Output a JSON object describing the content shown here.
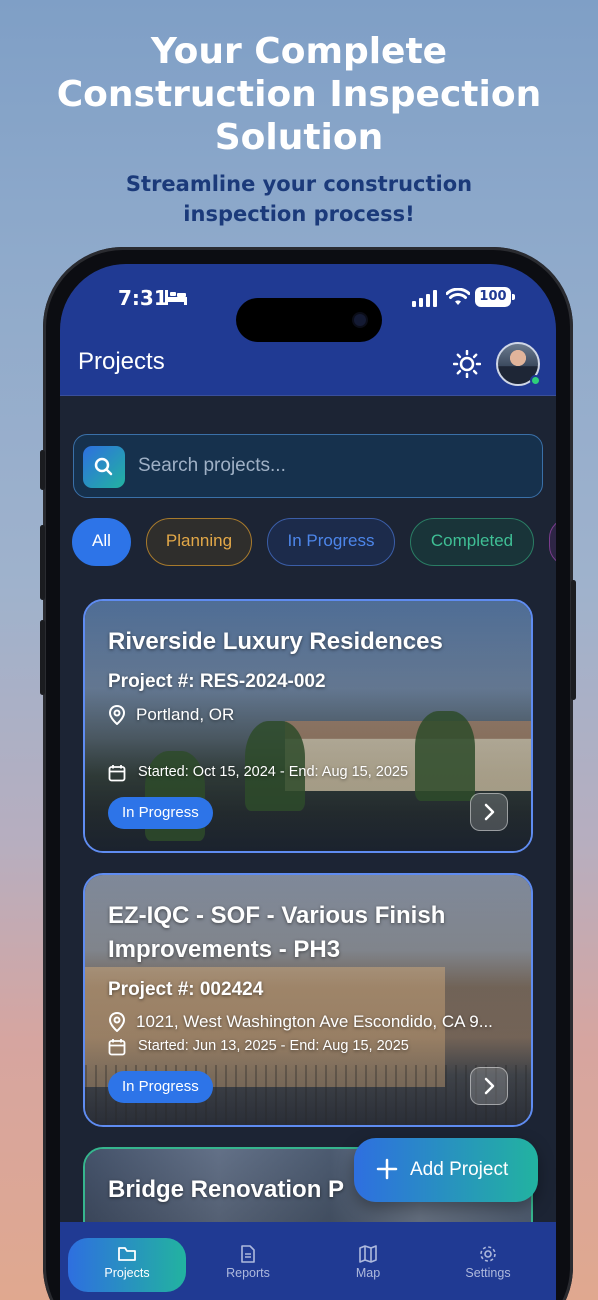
{
  "hero": {
    "title": "Your Complete Construction Inspection Solution",
    "subtitle": "Streamline your construction inspection process!"
  },
  "status_bar": {
    "time": "7:31",
    "battery": "100"
  },
  "header": {
    "title": "Projects"
  },
  "search": {
    "placeholder": "Search projects..."
  },
  "filters": [
    {
      "label": "All",
      "active": true
    },
    {
      "label": "Planning"
    },
    {
      "label": "In Progress"
    },
    {
      "label": "Completed"
    }
  ],
  "projects": [
    {
      "title": "Riverside Luxury Residences",
      "number": "Project #: RES-2024-002",
      "location": "Portland, OR",
      "dates": "Started: Oct 15, 2024 - End: Aug 15, 2025",
      "status": "In Progress"
    },
    {
      "title": "EZ-IQC - SOF - Various Finish Improvements - PH3",
      "number": "Project #: 002424",
      "location": "1021, West Washington Ave Escondido, CA 9...",
      "dates": "Started: Jun 13, 2025 - End: Aug 15, 2025",
      "status": "In Progress"
    },
    {
      "title": "Bridge Renovation P"
    }
  ],
  "fab": {
    "label": "Add Project"
  },
  "nav": [
    {
      "label": "Projects",
      "icon": "folder-icon",
      "active": true
    },
    {
      "label": "Reports",
      "icon": "document-icon"
    },
    {
      "label": "Map",
      "icon": "map-icon"
    },
    {
      "label": "Settings",
      "icon": "gear-icon"
    }
  ],
  "colors": {
    "app_bar": "#203a93",
    "accent_blue": "#2d74e8",
    "accent_teal": "#22b3a0",
    "planning": "#e3a848",
    "completed": "#3fbf95"
  }
}
